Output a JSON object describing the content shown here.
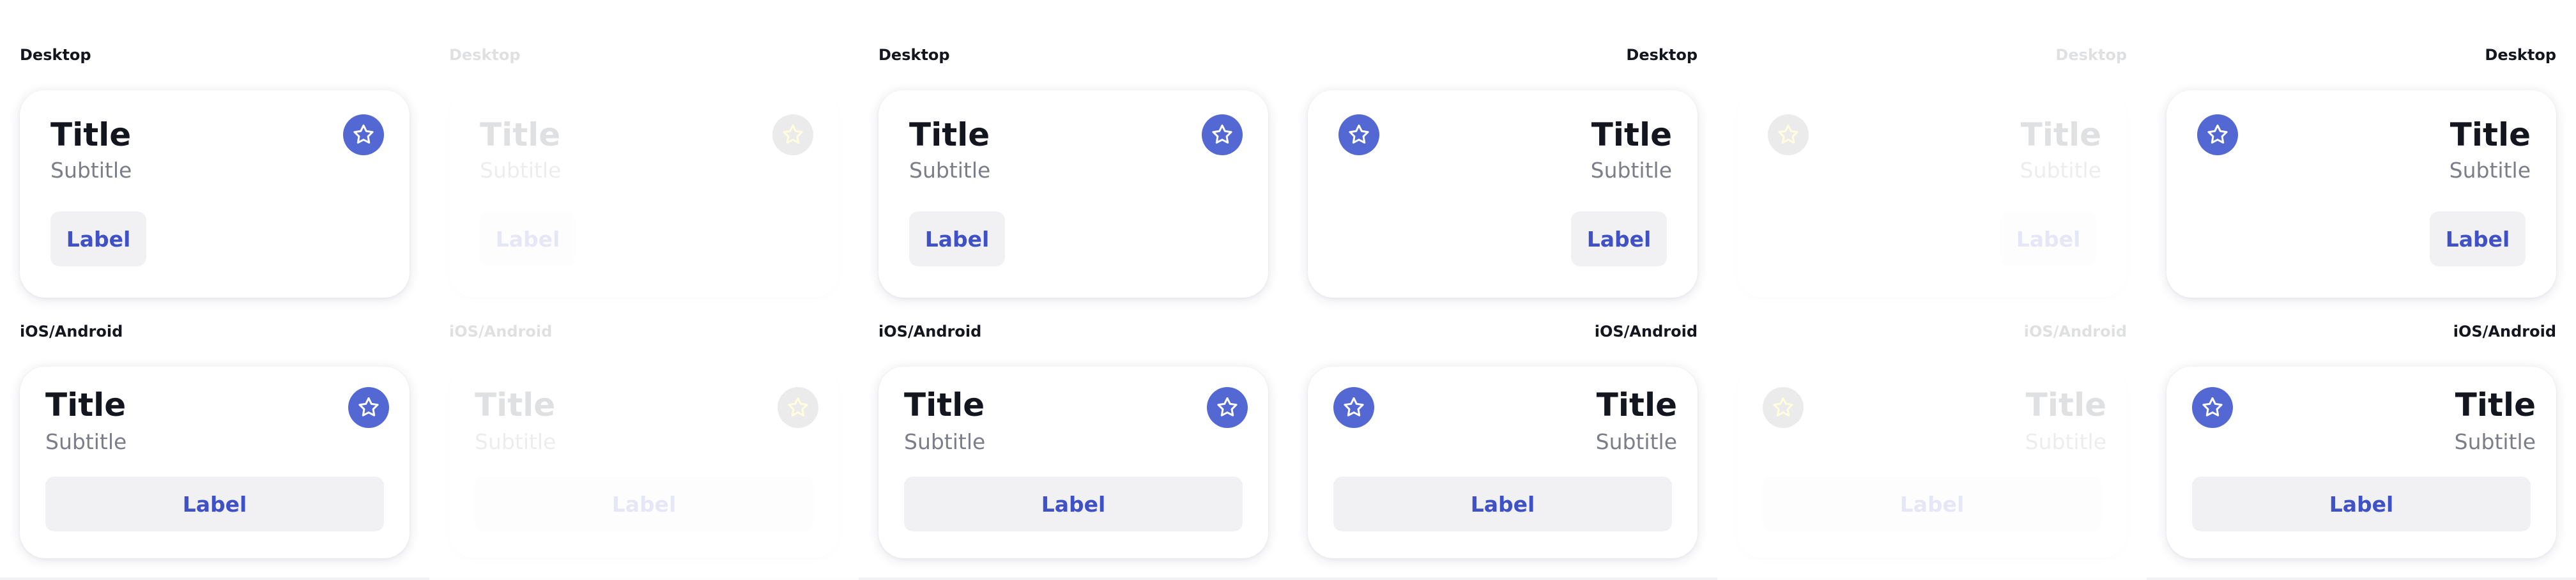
{
  "colors": {
    "accent": "#5468d4",
    "label_text": "#3f51c4",
    "title_text": "#14161f",
    "subtitle_text": "#7b7d88",
    "button_bg": "#f1f1f4",
    "disabled_star": "#fff20a"
  },
  "icon": "star-icon",
  "columns": [
    {
      "variant": "default",
      "direction": "ltr",
      "desktop": {
        "section_label": "Desktop",
        "title": "Title",
        "subtitle": "Subtitle",
        "button_label": "Label"
      },
      "mobile": {
        "section_label": "iOS/Android",
        "title": "Title",
        "subtitle": "Subtitle",
        "button_label": "Label"
      }
    },
    {
      "variant": "disabled",
      "direction": "ltr",
      "desktop": {
        "section_label": "Desktop",
        "title": "Title",
        "subtitle": "Subtitle",
        "button_label": "Label"
      },
      "mobile": {
        "section_label": "iOS/Android",
        "title": "Title",
        "subtitle": "Subtitle",
        "button_label": "Label"
      }
    },
    {
      "variant": "default",
      "direction": "ltr",
      "desktop": {
        "section_label": "Desktop",
        "title": "Title",
        "subtitle": "Subtitle",
        "button_label": "Label"
      },
      "mobile": {
        "section_label": "iOS/Android",
        "title": "Title",
        "subtitle": "Subtitle",
        "button_label": "Label"
      }
    },
    {
      "variant": "default",
      "direction": "rtl",
      "desktop": {
        "section_label": "Desktop",
        "title": "Title",
        "subtitle": "Subtitle",
        "button_label": "Label"
      },
      "mobile": {
        "section_label": "iOS/Android",
        "title": "Title",
        "subtitle": "Subtitle",
        "button_label": "Label"
      }
    },
    {
      "variant": "disabled",
      "direction": "rtl",
      "desktop": {
        "section_label": "Desktop",
        "title": "Title",
        "subtitle": "Subtitle",
        "button_label": "Label"
      },
      "mobile": {
        "section_label": "iOS/Android",
        "title": "Title",
        "subtitle": "Subtitle",
        "button_label": "Label"
      }
    },
    {
      "variant": "default",
      "direction": "rtl",
      "desktop": {
        "section_label": "Desktop",
        "title": "Title",
        "subtitle": "Subtitle",
        "button_label": "Label"
      },
      "mobile": {
        "section_label": "iOS/Android",
        "title": "Title",
        "subtitle": "Subtitle",
        "button_label": "Label"
      }
    }
  ]
}
